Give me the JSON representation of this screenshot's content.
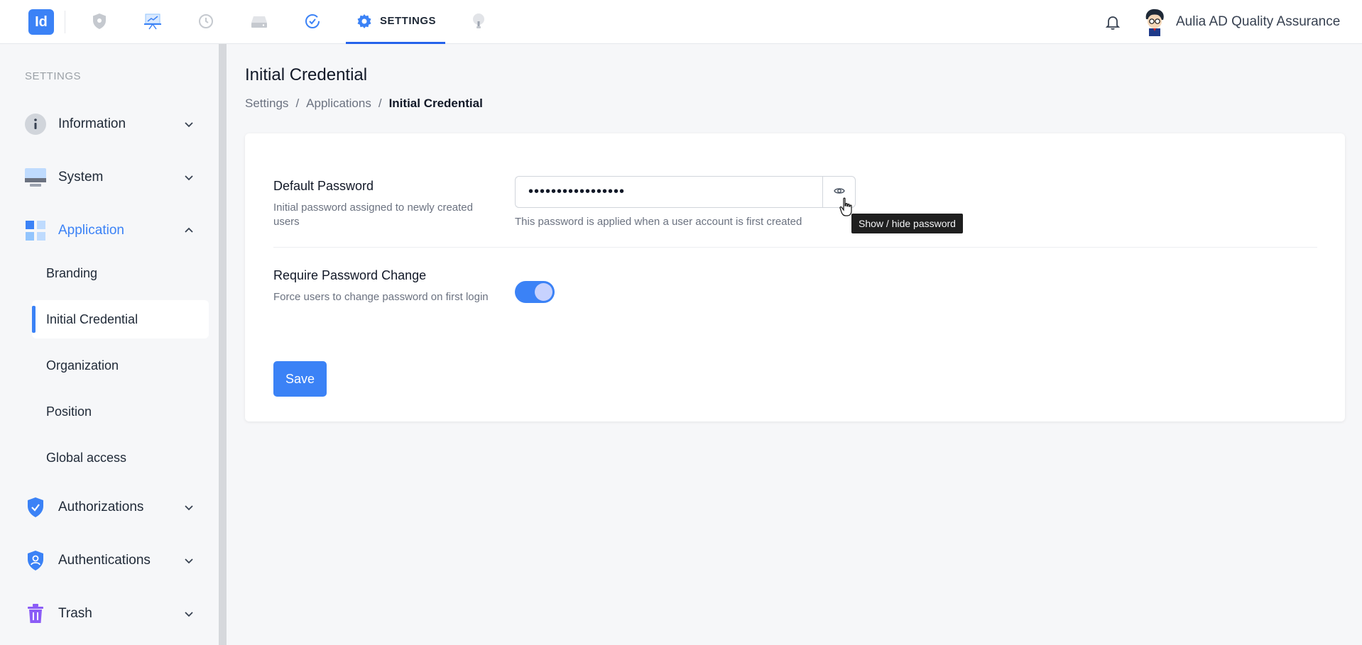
{
  "app": {
    "logo_text": "Id",
    "user_name": "Aulia AD Quality Assurance"
  },
  "topnav": {
    "items": [
      {
        "icon": "shield-icon"
      },
      {
        "icon": "presentation-icon"
      },
      {
        "icon": "history-icon"
      },
      {
        "icon": "drive-icon"
      },
      {
        "icon": "check-circle-icon"
      },
      {
        "icon": "settings-icon",
        "label": "SETTINGS",
        "active": true
      },
      {
        "icon": "lightbulb-icon"
      }
    ],
    "notifications_icon": "bell-icon"
  },
  "sidebar": {
    "heading": "SETTINGS",
    "groups": [
      {
        "label": "Information",
        "icon": "info-icon",
        "expanded": false
      },
      {
        "label": "System",
        "icon": "monitor-icon",
        "expanded": false
      },
      {
        "label": "Application",
        "icon": "grid-icon",
        "expanded": true,
        "active": true,
        "items": [
          {
            "label": "Branding"
          },
          {
            "label": "Initial Credential",
            "active": true
          },
          {
            "label": "Organization"
          },
          {
            "label": "Position"
          },
          {
            "label": "Global access"
          }
        ]
      },
      {
        "label": "Authorizations",
        "icon": "shield-check-icon",
        "expanded": false
      },
      {
        "label": "Authentications",
        "icon": "shield-user-icon",
        "expanded": false
      },
      {
        "label": "Trash",
        "icon": "trash-icon",
        "expanded": false
      }
    ]
  },
  "page": {
    "title": "Initial Credential",
    "breadcrumb": [
      "Settings",
      "Applications",
      "Initial Credential"
    ],
    "breadcrumb_sep": "/"
  },
  "form": {
    "default_password": {
      "label": "Default Password",
      "description": "Initial password assigned to newly created users",
      "value_masked": "•••••••••••••••••",
      "help": "This password is applied when a user account is first created",
      "toggle_tooltip": "Show / hide password"
    },
    "require_change": {
      "label": "Require Password Change",
      "description": "Force users to change password on first login",
      "enabled": true
    },
    "save_label": "Save"
  },
  "colors": {
    "accent": "#3b82f6",
    "background": "#f6f7f9"
  }
}
